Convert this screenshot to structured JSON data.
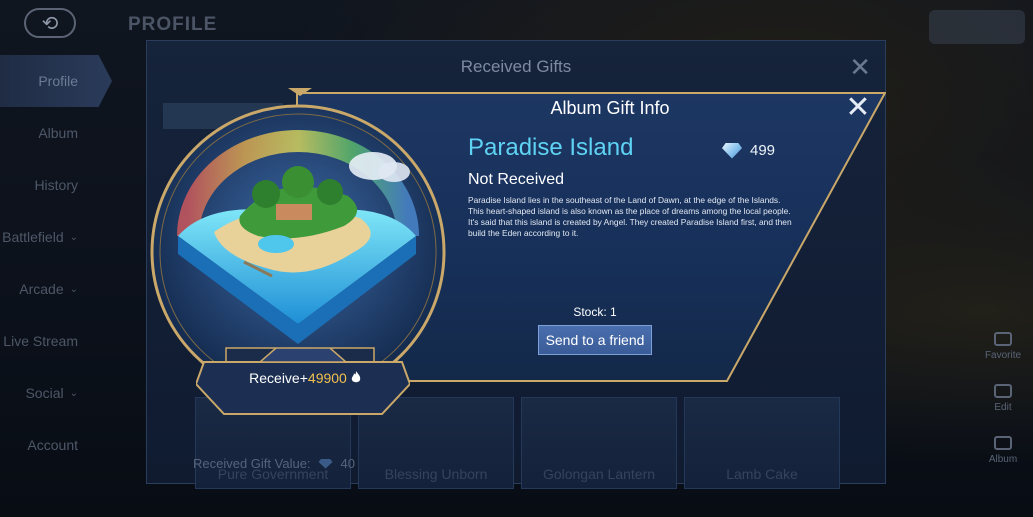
{
  "header": {
    "title": "PROFILE",
    "back_icon": "back-arrow-icon"
  },
  "side_nav": {
    "items": [
      {
        "label": "Profile",
        "active": true
      },
      {
        "label": "Album"
      },
      {
        "label": "History"
      },
      {
        "label": "Battlefield",
        "chevron": "⌄"
      },
      {
        "label": "Arcade",
        "chevron": "⌄"
      },
      {
        "label": "Live Stream"
      },
      {
        "label": "Social",
        "chevron": "⌄"
      },
      {
        "label": "Account"
      }
    ]
  },
  "right_rail": {
    "items": [
      {
        "label": "Favorite",
        "icon": "star-icon"
      },
      {
        "label": "Edit",
        "icon": "edit-icon"
      },
      {
        "label": "Album",
        "icon": "album-icon"
      }
    ]
  },
  "gifts_panel": {
    "title": "Received Gifts",
    "close_icon": "close-icon",
    "items": [
      {
        "name": "Pure Government"
      },
      {
        "name": "Blessing Unborn"
      },
      {
        "name": "Golongan Lantern"
      },
      {
        "name": "Lamb Cake"
      }
    ],
    "value_label": "Received Gift Value:",
    "value_icon": "diamond-icon",
    "value": "40"
  },
  "info_panel": {
    "title": "Album Gift Info",
    "close_icon": "close-icon",
    "gift_name": "Paradise Island",
    "price_icon": "diamond-icon",
    "price": "499",
    "status": "Not Received",
    "description": "Paradise Island lies in the southeast of the Land of Dawn, at the edge of the Islands. This heart-shaped island is also known as the place of dreams among the local people. It's said that this island is created by Angel. They created Paradise Island first, and then build the Eden according to it.",
    "stock": "Stock: 1",
    "send_button": "Send to a friend",
    "receive_label": "Receive+",
    "receive_amount": "49900",
    "receive_icon": "flame-icon"
  },
  "colors": {
    "accent_cyan": "#5fd3f4",
    "gold": "#c9a869",
    "receive_amount": "#f2c04e",
    "panel_blue": "#1d3763"
  }
}
